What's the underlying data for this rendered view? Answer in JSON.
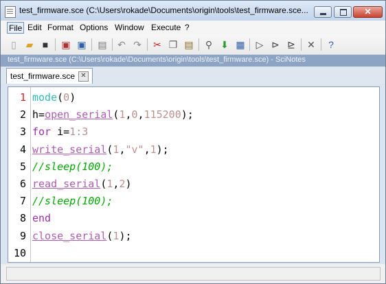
{
  "window": {
    "title": "test_firmware.sce (C:\\Users\\rokade\\Documents\\origin\\tools\\test_firmware.sce..."
  },
  "menu": [
    "File",
    "Edit",
    "Format",
    "Options",
    "Window",
    "Execute",
    "?"
  ],
  "toolbar_icons": [
    "new-file-icon",
    "open-folder-icon",
    "open-recent-icon",
    "save-icon",
    "save-as-icon",
    "print-icon",
    "undo-icon",
    "redo-icon",
    "cut-icon",
    "copy-icon",
    "paste-icon",
    "find-replace-icon",
    "download-icon",
    "variables-icon",
    "execute-icon",
    "execute-file-icon",
    "execute-until-icon",
    "tools-icon",
    "help-icon"
  ],
  "path_bar": "test_firmware.sce (C:\\Users\\rokade\\Documents\\origin\\tools\\test_firmware.sce) - SciNotes",
  "tab": {
    "label": "test_firmware.sce"
  },
  "editor": {
    "lines": [
      {
        "n": "1",
        "tokens": [
          {
            "t": "mode",
            "c": "builtin"
          },
          {
            "t": "(",
            "c": "plain"
          },
          {
            "t": "0",
            "c": "num"
          },
          {
            "t": ")",
            "c": "plain"
          }
        ]
      },
      {
        "n": "2",
        "tokens": [
          {
            "t": "h=",
            "c": "plain"
          },
          {
            "t": "open_serial",
            "c": "fn"
          },
          {
            "t": "(",
            "c": "plain"
          },
          {
            "t": "1",
            "c": "num"
          },
          {
            "t": ",",
            "c": "plain"
          },
          {
            "t": "0",
            "c": "num"
          },
          {
            "t": ",",
            "c": "plain"
          },
          {
            "t": "115200",
            "c": "num"
          },
          {
            "t": ");",
            "c": "plain"
          }
        ]
      },
      {
        "n": "3",
        "tokens": [
          {
            "t": "for",
            "c": "key"
          },
          {
            "t": " i=",
            "c": "plain"
          },
          {
            "t": "1",
            "c": "num"
          },
          {
            "t": ":",
            "c": "range"
          },
          {
            "t": "3",
            "c": "num"
          }
        ]
      },
      {
        "n": "4",
        "tokens": [
          {
            "t": "write_serial",
            "c": "fn"
          },
          {
            "t": "(",
            "c": "plain"
          },
          {
            "t": "1",
            "c": "num"
          },
          {
            "t": ",",
            "c": "plain"
          },
          {
            "t": "\"v\"",
            "c": "str"
          },
          {
            "t": ",",
            "c": "plain"
          },
          {
            "t": "1",
            "c": "num"
          },
          {
            "t": ");",
            "c": "plain"
          }
        ]
      },
      {
        "n": "5",
        "tokens": [
          {
            "t": "//sleep(100);",
            "c": "comment"
          }
        ]
      },
      {
        "n": "6",
        "tokens": [
          {
            "t": "read_serial",
            "c": "fn"
          },
          {
            "t": "(",
            "c": "plain"
          },
          {
            "t": "1",
            "c": "num"
          },
          {
            "t": ",",
            "c": "plain"
          },
          {
            "t": "2",
            "c": "num"
          },
          {
            "t": ")",
            "c": "plain"
          }
        ]
      },
      {
        "n": "7",
        "tokens": [
          {
            "t": "//sleep(100);",
            "c": "comment"
          }
        ]
      },
      {
        "n": "8",
        "tokens": [
          {
            "t": "end",
            "c": "key"
          }
        ]
      },
      {
        "n": "9",
        "tokens": [
          {
            "t": "close_serial",
            "c": "fn"
          },
          {
            "t": "(",
            "c": "plain"
          },
          {
            "t": "1",
            "c": "num"
          },
          {
            "t": ");",
            "c": "plain"
          }
        ]
      },
      {
        "n": "10",
        "tokens": []
      }
    ],
    "current_line": "1"
  },
  "status_bar": {
    "text": ""
  }
}
